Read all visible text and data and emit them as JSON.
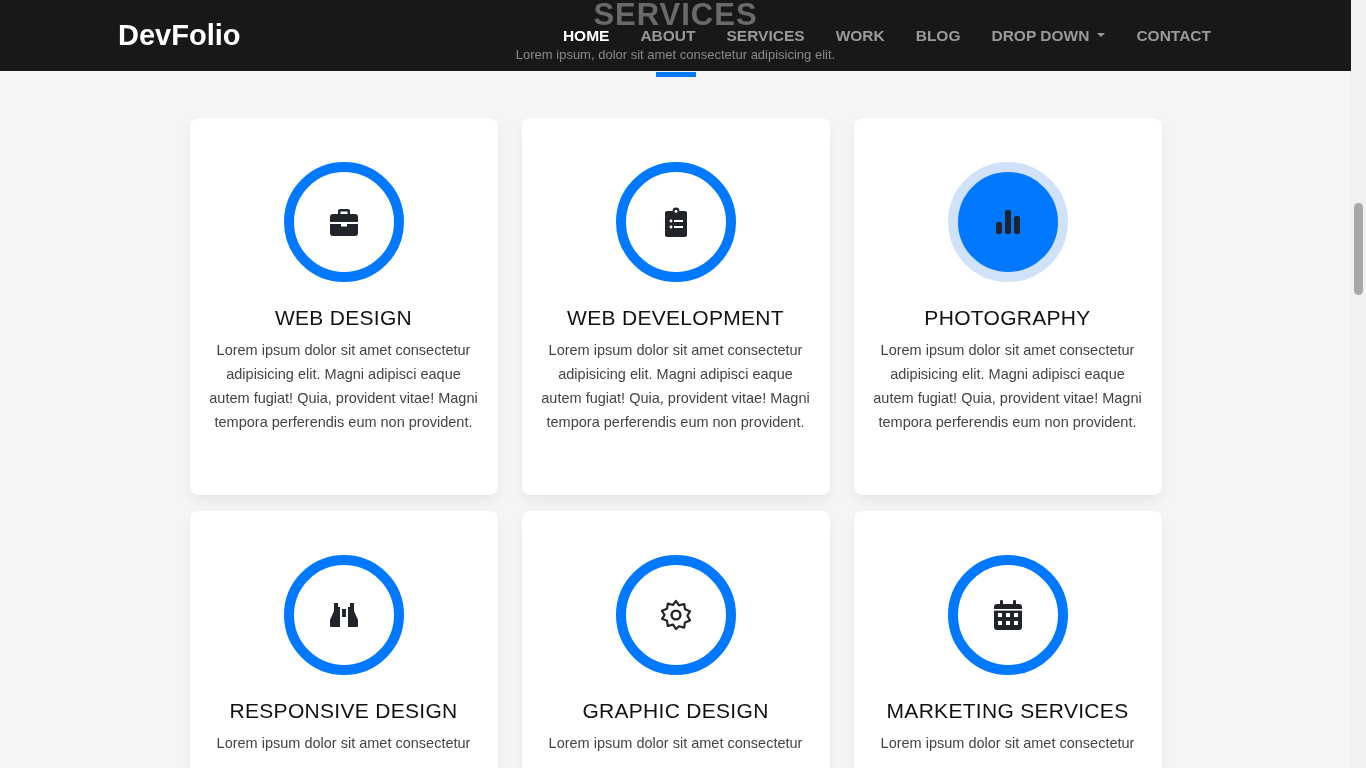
{
  "navbar": {
    "brand": "DevFolio",
    "links": [
      {
        "label": "HOME",
        "selected": true,
        "dropdown": false
      },
      {
        "label": "ABOUT",
        "selected": false,
        "dropdown": false
      },
      {
        "label": "SERVICES",
        "selected": false,
        "dropdown": false
      },
      {
        "label": "WORK",
        "selected": false,
        "dropdown": false
      },
      {
        "label": "BLOG",
        "selected": false,
        "dropdown": false
      },
      {
        "label": "DROP DOWN",
        "selected": false,
        "dropdown": true
      },
      {
        "label": "CONTACT",
        "selected": false,
        "dropdown": false
      }
    ]
  },
  "section": {
    "title": "SERVICES",
    "subtitle": "Lorem ipsum, dolor sit amet consectetur adipisicing elit."
  },
  "services": [
    {
      "kind": "briefcase",
      "title": "WEB DESIGN",
      "text": "Lorem ipsum dolor sit amet consectetur adipisicing elit. Magni adipisci eaque autem fugiat! Quia, provident vitae! Magni tempora perferendis eum non provident.",
      "highlighted": false
    },
    {
      "kind": "clipboard",
      "title": "WEB DEVELOPMENT",
      "text": "Lorem ipsum dolor sit amet consectetur adipisicing elit. Magni adipisci eaque autem fugiat! Quia, provident vitae! Magni tempora perferendis eum non provident.",
      "highlighted": false
    },
    {
      "kind": "chart",
      "title": "PHOTOGRAPHY",
      "text": "Lorem ipsum dolor sit amet consectetur adipisicing elit. Magni adipisci eaque autem fugiat! Quia, provident vitae! Magni tempora perferendis eum non provident.",
      "highlighted": true
    },
    {
      "kind": "binoculars",
      "title": "RESPONSIVE DESIGN",
      "text": "Lorem ipsum dolor sit amet consectetur",
      "highlighted": false
    },
    {
      "kind": "gear",
      "title": "GRAPHIC DESIGN",
      "text": "Lorem ipsum dolor sit amet consectetur",
      "highlighted": false
    },
    {
      "kind": "calendar",
      "title": "MARKETING SERVICES",
      "text": "Lorem ipsum dolor sit amet consectetur",
      "highlighted": false
    }
  ]
}
